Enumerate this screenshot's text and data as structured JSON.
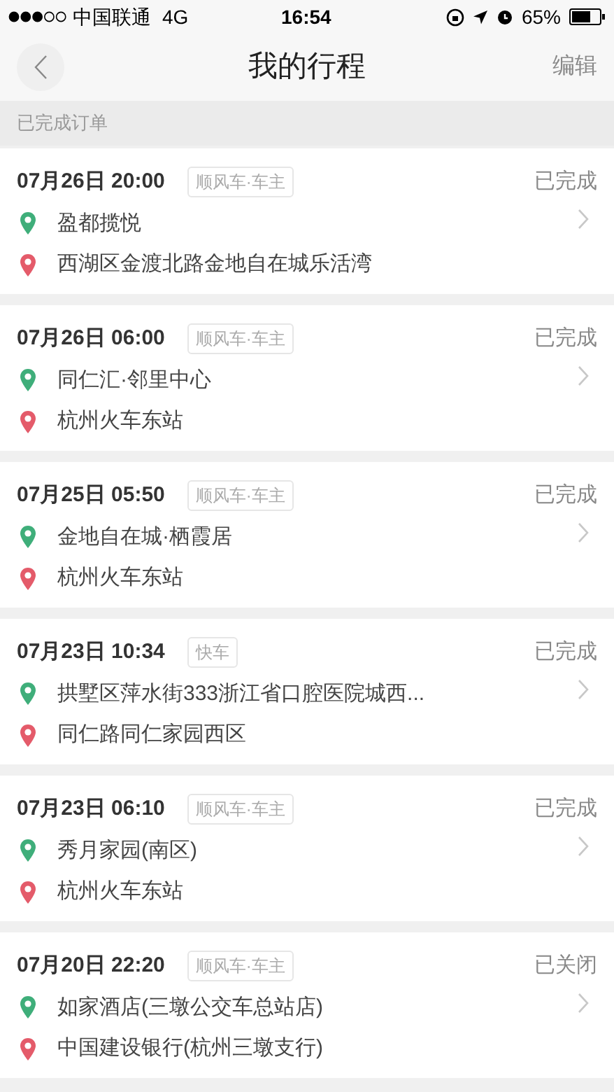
{
  "status_bar": {
    "carrier": "中国联通",
    "network": "4G",
    "time": "16:54",
    "battery": "65%"
  },
  "nav": {
    "title": "我的行程",
    "action": "编辑"
  },
  "section_title": "已完成订单",
  "trips": [
    {
      "datetime": "07月26日 20:00",
      "tag": "顺风车·车主",
      "status": "已完成",
      "from": "盈都揽悦",
      "to": "西湖区金渡北路金地自在城乐活湾"
    },
    {
      "datetime": "07月26日 06:00",
      "tag": "顺风车·车主",
      "status": "已完成",
      "from": "同仁汇·邻里中心",
      "to": "杭州火车东站"
    },
    {
      "datetime": "07月25日 05:50",
      "tag": "顺风车·车主",
      "status": "已完成",
      "from": "金地自在城·栖霞居",
      "to": "杭州火车东站"
    },
    {
      "datetime": "07月23日 10:34",
      "tag": "快车",
      "status": "已完成",
      "from": "拱墅区萍水街333浙江省口腔医院城西...",
      "to": "同仁路同仁家园西区"
    },
    {
      "datetime": "07月23日 06:10",
      "tag": "顺风车·车主",
      "status": "已完成",
      "from": "秀月家园(南区)",
      "to": "杭州火车东站"
    },
    {
      "datetime": "07月20日 22:20",
      "tag": "顺风车·车主",
      "status": "已关闭",
      "from": "如家酒店(三墩公交车总站店)",
      "to": "中国建设银行(杭州三墩支行)"
    }
  ]
}
